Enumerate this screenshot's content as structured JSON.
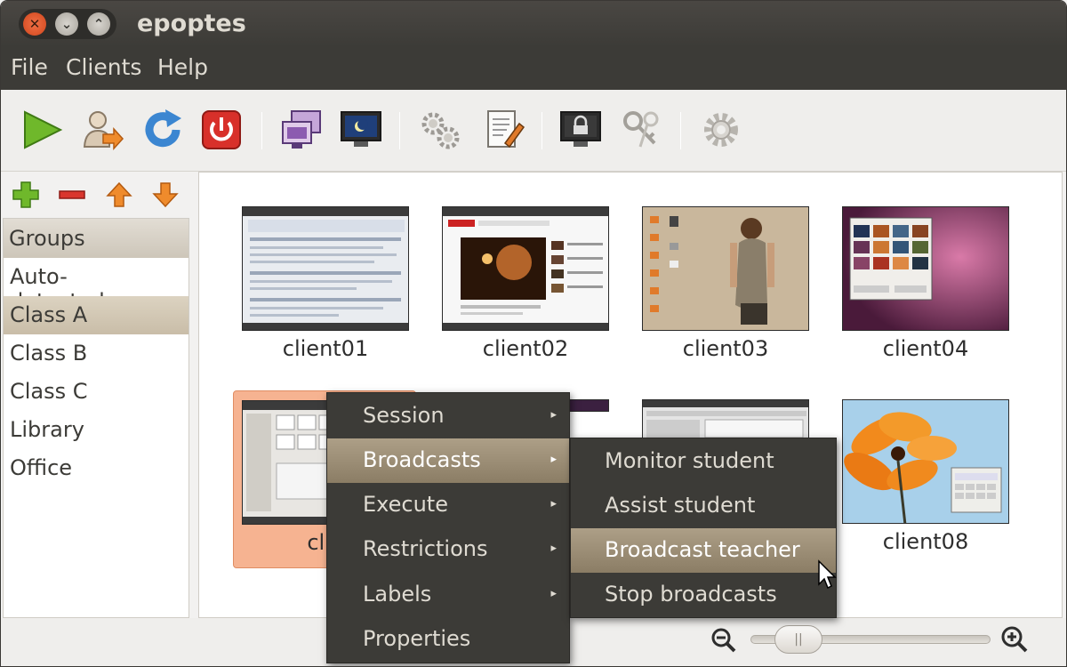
{
  "window": {
    "title": "epoptes"
  },
  "menubar": {
    "items": [
      "File",
      "Clients",
      "Help"
    ]
  },
  "toolbar": {
    "icons": [
      "play-icon",
      "user-arrow-icon",
      "refresh-icon",
      "power-icon",
      "screens-icon",
      "monitor-night-icon",
      "gears-icon",
      "edit-document-icon",
      "lock-screen-icon",
      "keys-icon",
      "settings-icon"
    ]
  },
  "sidebar": {
    "tools": [
      "add-icon",
      "remove-icon",
      "move-up-icon",
      "move-down-icon"
    ],
    "header": "Groups",
    "groups": [
      "Auto-detected...",
      "Class A",
      "Class B",
      "Class C",
      "Library",
      "Office"
    ],
    "selected": "Class A"
  },
  "clients": [
    {
      "name": "client01"
    },
    {
      "name": "client02"
    },
    {
      "name": "client03"
    },
    {
      "name": "client04"
    },
    {
      "name": "clie"
    },
    {
      "name": "client08"
    }
  ],
  "context_menu": {
    "items": [
      {
        "label": "Session",
        "has_submenu": true
      },
      {
        "label": "Broadcasts",
        "has_submenu": true,
        "highlighted": true
      },
      {
        "label": "Execute",
        "has_submenu": true
      },
      {
        "label": "Restrictions",
        "has_submenu": true
      },
      {
        "label": "Labels",
        "has_submenu": true
      },
      {
        "label": "Properties",
        "has_submenu": false
      }
    ],
    "submenu": [
      {
        "label": "Monitor student"
      },
      {
        "label": "Assist student"
      },
      {
        "label": "Broadcast teacher",
        "highlighted": true
      },
      {
        "label": "Stop broadcasts"
      }
    ],
    "arrow_glyph": "▸"
  },
  "statusbar": {
    "thumb_glyph": "||"
  },
  "colors": {
    "accent": "#8b7d65",
    "selection": "#f6b391",
    "titlebar": "#3c3b37",
    "close": "#df4a16"
  }
}
